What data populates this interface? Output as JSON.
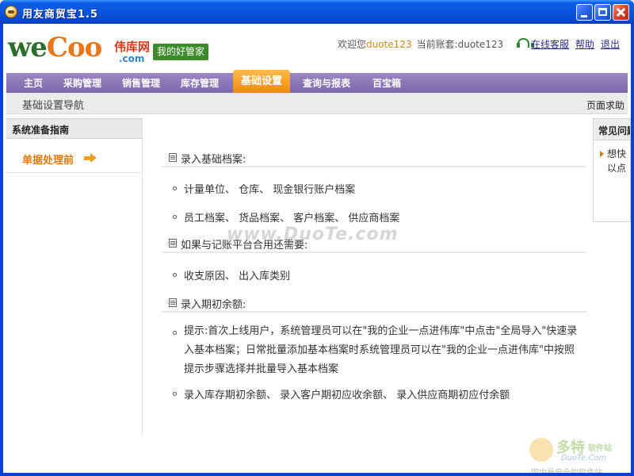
{
  "window": {
    "title": "用友商贸宝1.5",
    "icon": "app-icon"
  },
  "header": {
    "logo_we": "we",
    "logo_coo": "Coo",
    "logo_cn": "伟库网",
    "logo_com": ".com",
    "slogan": "我的好管家",
    "welcome_prefix": "欢迎您",
    "user_name": "duote123",
    "account_prefix": "当前账套:",
    "account_name": "duote123",
    "service_label": "在线客服",
    "help_label": "帮助",
    "exit_label": "退出"
  },
  "nav": {
    "items": [
      {
        "label": "主页"
      },
      {
        "label": "采购管理"
      },
      {
        "label": "销售管理"
      },
      {
        "label": "库存管理"
      },
      {
        "label": "基础设置"
      },
      {
        "label": "查询与报表"
      },
      {
        "label": "百宝箱"
      }
    ],
    "active_index": 4
  },
  "subheader": {
    "title": "基础设置导航",
    "page_help": "页面求助"
  },
  "sidebar": {
    "heading": "系统准备指南",
    "link": "单据处理前"
  },
  "main": {
    "sections": [
      {
        "heading": "录入基础档案:",
        "items": [
          "计量单位、 仓库、 现金银行账户档案",
          "员工档案、 货品档案、 客户档案、 供应商档案"
        ]
      },
      {
        "heading": "如果与记账平台合用还需要:",
        "items": [
          "收支原因、 出入库类别"
        ]
      },
      {
        "heading": "录入期初余额:",
        "items": [
          "提示:首次上线用户，系统管理员可以在\"我的企业一点进伟库\"中点击\"全局导入\"快速录入基本档案；日常批量添加基本档案时系统管理员可以在\"我的企业一点进伟库\"中按照提示步骤选择并批量导入基本档案",
          "录入库存期初余额、 录入客户期初应收余额、 录入供应商期初应付余额"
        ]
      }
    ]
  },
  "faq": {
    "heading": "常见问题",
    "line1": "想快",
    "line2": "以点"
  },
  "watermarks": {
    "center": "www.DuoTe.com",
    "brand": "多特",
    "brand_sub": "软件站",
    "url": "DuoTe.Com",
    "tagline": "国内最安全的软件站"
  },
  "colors": {
    "titlebar": "#0a55dc",
    "nav": "#8a75b8",
    "nav_active": "#f29a22",
    "brand_green": "#3b8b2a",
    "link_orange": "#e07810"
  }
}
